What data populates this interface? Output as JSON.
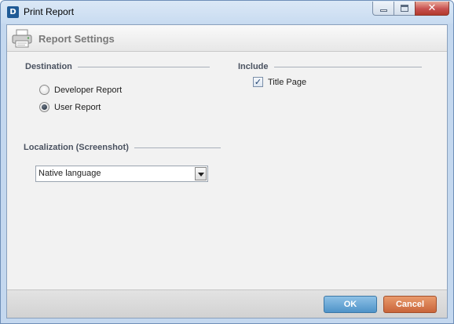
{
  "window": {
    "app_icon_letter": "D",
    "title": "Print Report",
    "controls": [
      "minimize",
      "maximize",
      "close"
    ],
    "close_glyph": "✕"
  },
  "header": {
    "icon": "printer-icon",
    "title": "Report Settings"
  },
  "destination": {
    "label": "Destination",
    "options": [
      {
        "label": "Developer Report",
        "checked": false
      },
      {
        "label": "User Report",
        "checked": true
      }
    ]
  },
  "include": {
    "label": "Include",
    "title_page": {
      "label": "Title Page",
      "checked": true,
      "glyph": "✓"
    }
  },
  "localization": {
    "label": "Localization (Screenshot)",
    "selected": "Native language"
  },
  "footer": {
    "ok_label": "OK",
    "cancel_label": "Cancel"
  },
  "colors": {
    "ok_button": "#5a9bd0",
    "cancel_button": "#d0703f",
    "section_label": "#4a5260"
  }
}
